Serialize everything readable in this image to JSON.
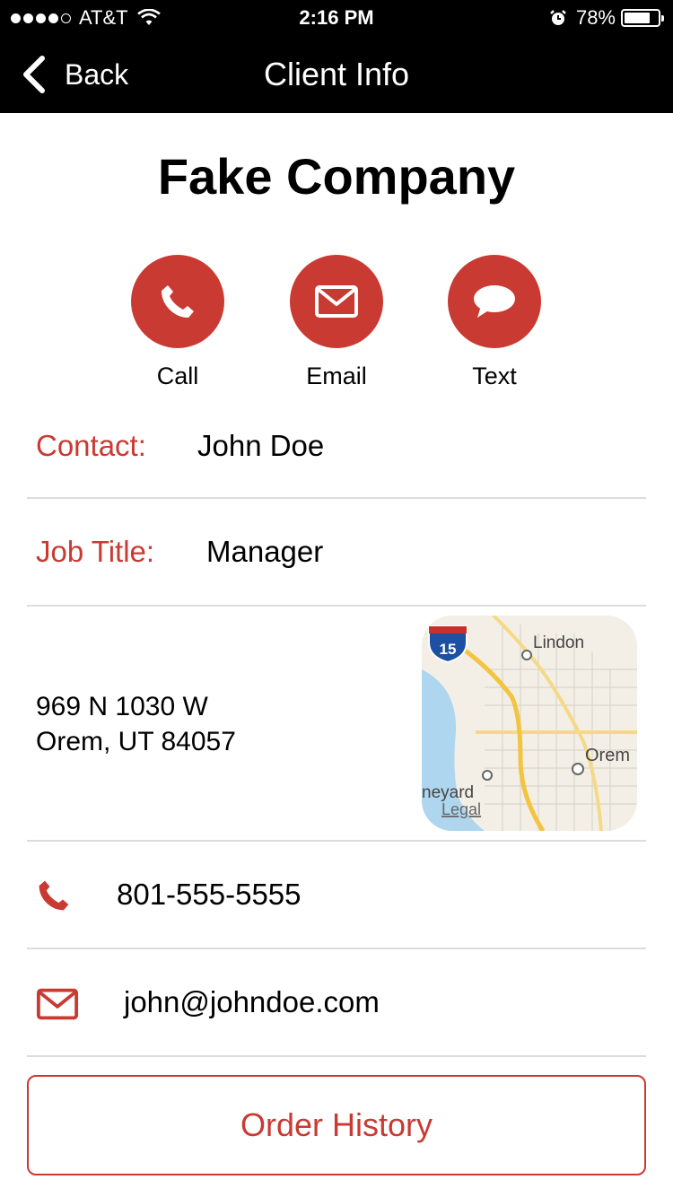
{
  "status_bar": {
    "carrier": "AT&T",
    "signal_bars_filled": 4,
    "signal_bars_total": 5,
    "time": "2:16 PM",
    "battery_percent": "78%",
    "battery_level": 0.78,
    "icons": [
      "wifi-icon",
      "alarm-icon",
      "battery-icon"
    ]
  },
  "nav": {
    "back_label": "Back",
    "title": "Client Info"
  },
  "company": {
    "name": "Fake Company"
  },
  "actions": {
    "call_label": "Call",
    "email_label": "Email",
    "text_label": "Text"
  },
  "details": {
    "contact_label": "Contact:",
    "contact_value": "John Doe",
    "job_title_label": "Job Title:",
    "job_title_value": "Manager",
    "address_line1": "969 N 1030 W",
    "address_line2": "Orem, UT 84057",
    "phone": "801-555-5555",
    "email": "john@johndoe.com"
  },
  "map": {
    "highway_shield": "15",
    "labels": {
      "lindon": "Lindon",
      "orem": "Orem",
      "vineyard": "neyard",
      "legal": "Legal"
    }
  },
  "order_history_label": "Order History",
  "colors": {
    "accent": "#c93a32",
    "bar_background": "#000000",
    "divider": "#dcdcdc"
  }
}
